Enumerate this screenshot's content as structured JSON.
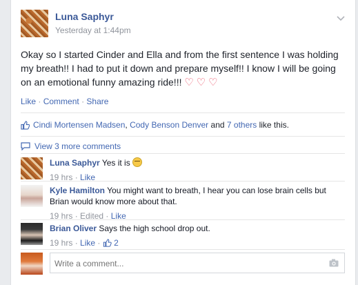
{
  "post": {
    "author": "Luna Saphyr",
    "time": "Yesterday at 1:44pm",
    "text_line1": "Okay so I started Cinder and Ella and from the first sentence I was holding",
    "text_line2": "my breath!! I had to put it down and prepare myself!! I know I will be going",
    "text_line3": "on an emotional funny amazing ride!!!",
    "hearts": [
      "♡",
      "♡",
      "♡"
    ]
  },
  "actions": {
    "like": "Like",
    "comment": "Comment",
    "share": "Share",
    "sep": "·"
  },
  "likes": {
    "person1": "Cindi Mortensen Madsen",
    "comma": ",",
    "person2": "Cody Benson Denver",
    "and": "and",
    "others": "7 others",
    "suffix": "like this."
  },
  "view_more": "View 3 more comments",
  "comments": [
    {
      "name": "Luna Saphyr",
      "text": "Yes it is",
      "time": "19 hrs",
      "like": "Like"
    },
    {
      "name": "Kyle Hamilton",
      "text": "You might want to breath, I hear you can lose brain cells but",
      "text2": "Brian would know more about that.",
      "time": "19 hrs",
      "edited": "Edited",
      "like": "Like"
    },
    {
      "name": "Brian Oliver",
      "text": "Says the high school drop out.",
      "time": "19 hrs",
      "like": "Like",
      "like_count": "2"
    }
  ],
  "composer": {
    "placeholder": "Write a comment..."
  },
  "icons": {
    "menu": "chevron-down-icon",
    "thumb": "thumbs-up-icon",
    "comment": "comment-bubble-icon",
    "camera": "camera-icon"
  },
  "colors": {
    "link": "#3b5998",
    "heart": "#e8465c",
    "muted": "#90949c"
  }
}
